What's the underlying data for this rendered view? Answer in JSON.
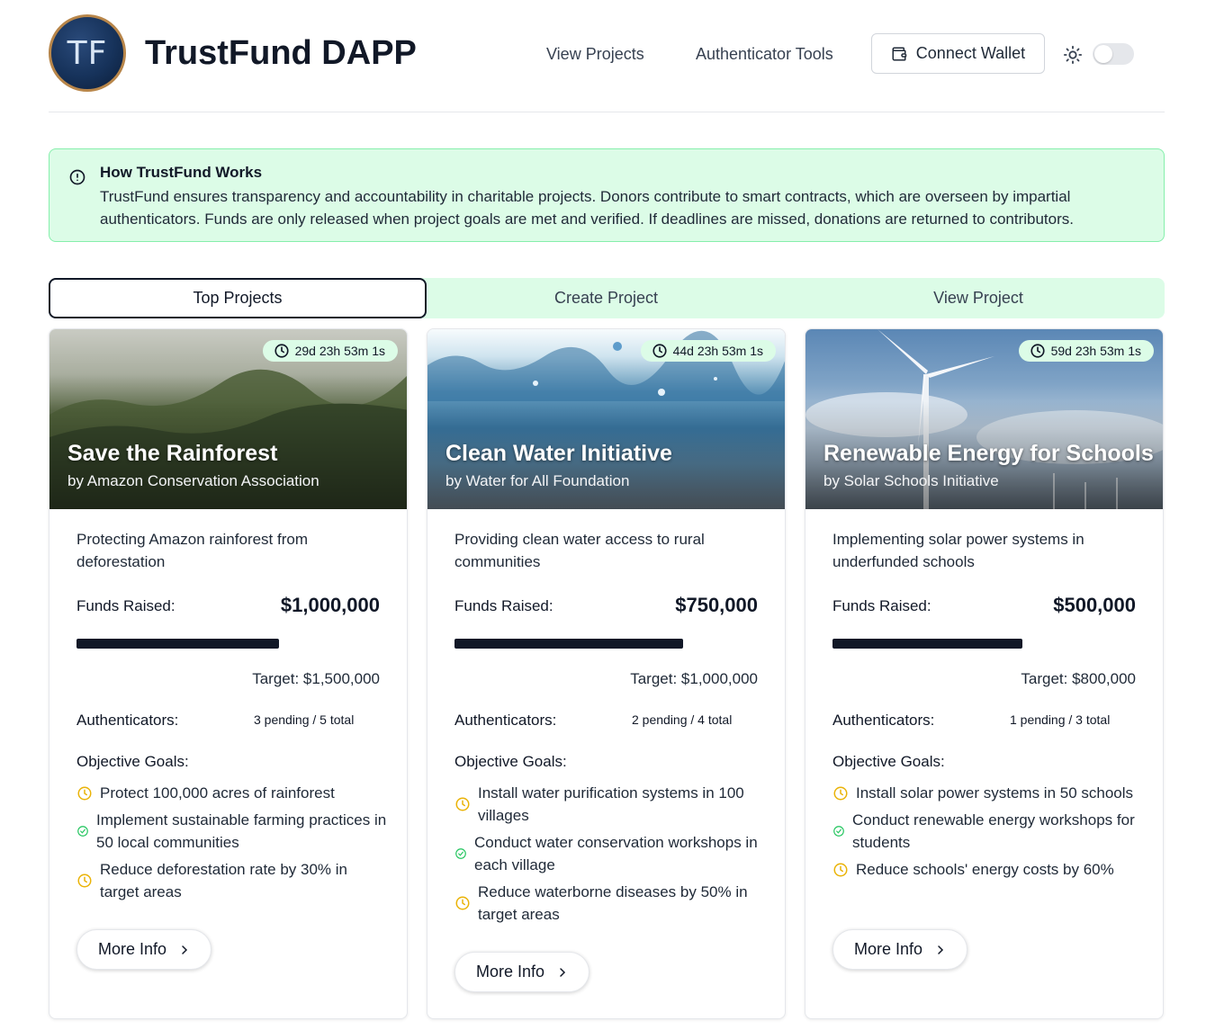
{
  "header": {
    "logo_text": "TF",
    "title": "TrustFund DAPP",
    "nav": [
      "View Projects",
      "Authenticator Tools"
    ],
    "connect_wallet": "Connect Wallet",
    "theme_icon": "sun-icon",
    "theme_toggle_on": false
  },
  "alert": {
    "title": "How TrustFund Works",
    "body": "TrustFund ensures transparency and accountability in charitable projects. Donors contribute to smart contracts, which are overseen by impartial authenticators. Funds are only released when project goals are met and verified. If deadlines are missed, donations are returned to contributors."
  },
  "tabs": [
    {
      "label": "Top Projects",
      "active": true
    },
    {
      "label": "Create Project",
      "active": false
    },
    {
      "label": "View Project",
      "active": false
    }
  ],
  "labels": {
    "funds_raised": "Funds Raised:",
    "authenticators": "Authenticators:",
    "objective_goals": "Objective Goals:",
    "more_info": "More Info"
  },
  "colors": {
    "accent_green_bg": "#dcfce7",
    "goal_pending": "#eab308",
    "goal_done": "#22c55e"
  },
  "projects": [
    {
      "timer": "29d 23h 53m 1s",
      "title": "Save the Rainforest",
      "org": "by Amazon Conservation Association",
      "description": "Protecting Amazon rainforest from deforestation",
      "funds_raised": "$1,000,000",
      "progress_fraction": 0.667,
      "target": "Target: $1,500,000",
      "authenticators": "3 pending / 5 total",
      "goals": [
        {
          "text": "Protect 100,000 acres of rainforest",
          "status": "pending"
        },
        {
          "text": "Implement sustainable farming practices in 50 local communities",
          "status": "done"
        },
        {
          "text": "Reduce deforestation rate by 30% in target areas",
          "status": "pending"
        }
      ]
    },
    {
      "timer": "44d 23h 53m 1s",
      "title": "Clean Water Initiative",
      "org": "by Water for All Foundation",
      "description": "Providing clean water access to rural communities",
      "funds_raised": "$750,000",
      "progress_fraction": 0.75,
      "target": "Target: $1,000,000",
      "authenticators": "2 pending / 4 total",
      "goals": [
        {
          "text": "Install water purification systems in 100 villages",
          "status": "pending"
        },
        {
          "text": "Conduct water conservation workshops in each village",
          "status": "done"
        },
        {
          "text": "Reduce waterborne diseases by 50% in target areas",
          "status": "pending"
        }
      ]
    },
    {
      "timer": "59d 23h 53m 1s",
      "title": "Renewable Energy for Schools",
      "org": "by Solar Schools Initiative",
      "description": "Implementing solar power systems in underfunded schools",
      "funds_raised": "$500,000",
      "progress_fraction": 0.625,
      "target": "Target: $800,000",
      "authenticators": "1 pending / 3 total",
      "goals": [
        {
          "text": "Install solar power systems in 50 schools",
          "status": "pending"
        },
        {
          "text": "Conduct renewable energy workshops for students",
          "status": "done"
        },
        {
          "text": "Reduce schools' energy costs by 60%",
          "status": "pending"
        }
      ]
    }
  ]
}
